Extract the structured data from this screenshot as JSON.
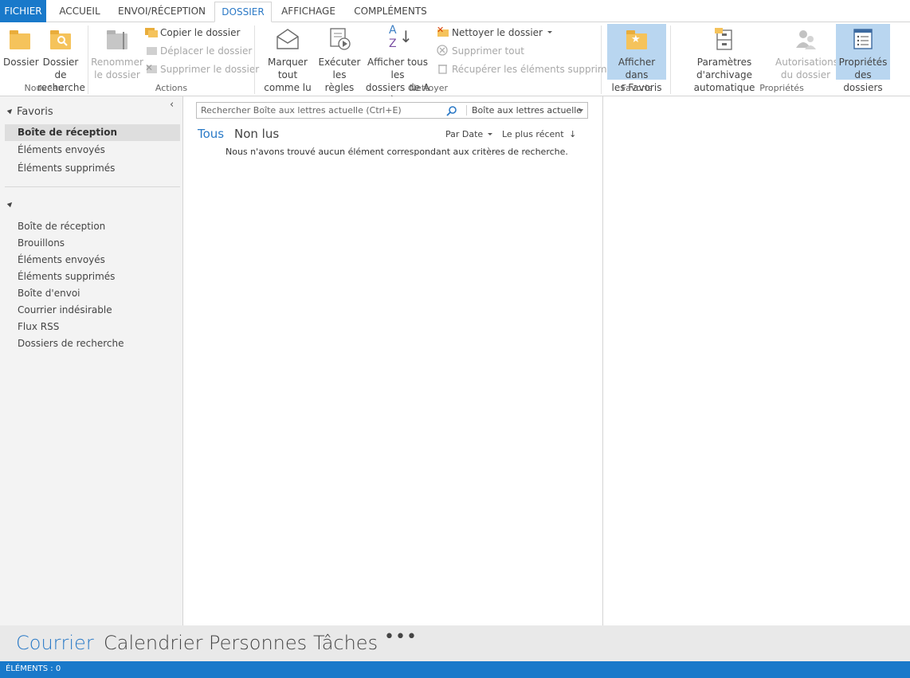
{
  "tabs": {
    "file": "FICHIER",
    "home": "ACCUEIL",
    "send_receive": "ENVOI/RÉCEPTION",
    "folder": "DOSSIER",
    "view": "AFFICHAGE",
    "addins": "COMPLÉMENTS"
  },
  "ribbon": {
    "new_group": {
      "label": "Nouveau",
      "folder_btn": "Dossier",
      "search_folder_btn_l1": "Dossier de",
      "search_folder_btn_l2": "recherche"
    },
    "actions_group": {
      "label": "Actions",
      "rename_l1": "Renommer",
      "rename_l2": "le dossier",
      "copy": "Copier le dossier",
      "move": "Déplacer le dossier",
      "delete": "Supprimer le dossier"
    },
    "clean_group": {
      "label": "Nettoyer",
      "mark_all_l1": "Marquer tout",
      "mark_all_l2": "comme lu",
      "run_rules_l1": "Exécuter",
      "run_rules_l2": "les règles",
      "show_all_l1": "Afficher tous les",
      "show_all_l2": "dossiers de A à Z",
      "clean_folder": "Nettoyer le dossier",
      "delete_all": "Supprimer tout",
      "recover": "Récupérer les éléments supprimés"
    },
    "favorites_group": {
      "label": "Favoris",
      "show_in_fav_l1": "Afficher dans",
      "show_in_fav_l2": "les Favoris"
    },
    "properties_group": {
      "label": "Propriétés",
      "autoarchive_l1": "Paramètres d'archivage",
      "autoarchive_l2": "automatique",
      "permissions_l1": "Autorisations",
      "permissions_l2": "du dossier",
      "folder_props_l1": "Propriétés",
      "folder_props_l2": "des dossiers"
    }
  },
  "nav": {
    "collapse_glyph": "‹",
    "favorites_header": "Favoris",
    "favorites": [
      "Boîte de réception",
      "Éléments envoyés",
      "Éléments supprimés"
    ],
    "account_header": "",
    "folders": [
      "Boîte de réception",
      "Brouillons",
      "Éléments envoyés",
      "Éléments supprimés",
      "Boîte d'envoi",
      "Courrier indésirable",
      "Flux RSS",
      "Dossiers de recherche"
    ]
  },
  "list": {
    "search_placeholder": "Rechercher Boîte aux lettres actuelle (Ctrl+E)",
    "search_scope": "Boîte aux lettres actuelle",
    "filter_all": "Tous",
    "filter_unread": "Non lus",
    "sort_by": "Par Date",
    "sort_order": "Le plus récent",
    "empty_message": "Nous n'avons trouvé aucun élément correspondant aux critères de recherche."
  },
  "bottom_nav": {
    "mail": "Courrier",
    "calendar": "Calendrier",
    "people": "Personnes",
    "tasks": "Tâches",
    "more": "•••"
  },
  "status": {
    "items": "ÉLÉMENTS : 0"
  },
  "colors": {
    "accent": "#1979ca",
    "selected_ribbon": "#b9d6f0",
    "nav_bg": "#f3f3f3"
  }
}
